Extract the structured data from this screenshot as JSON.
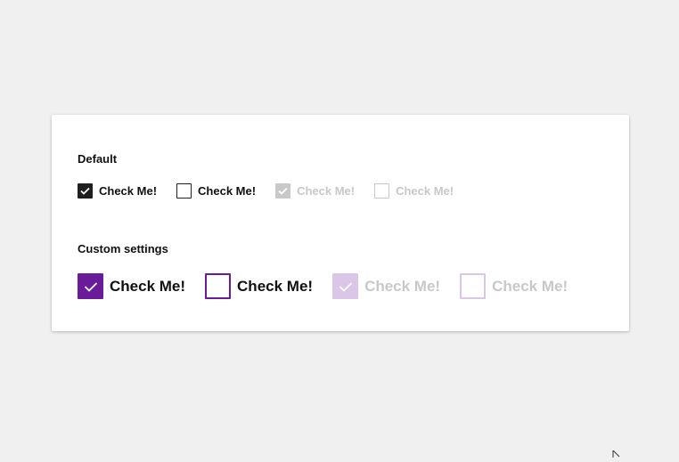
{
  "sections": [
    {
      "title": "Default",
      "checkboxes": [
        {
          "label": "Check Me!",
          "checked": true,
          "disabled": false
        },
        {
          "label": "Check Me!",
          "checked": false,
          "disabled": false
        },
        {
          "label": "Check Me!",
          "checked": true,
          "disabled": true
        },
        {
          "label": "Check Me!",
          "checked": false,
          "disabled": true
        }
      ]
    },
    {
      "title": "Custom settings",
      "checkboxes": [
        {
          "label": "Check Me!",
          "checked": true,
          "disabled": false
        },
        {
          "label": "Check Me!",
          "checked": false,
          "disabled": false
        },
        {
          "label": "Check Me!",
          "checked": true,
          "disabled": true
        },
        {
          "label": "Check Me!",
          "checked": false,
          "disabled": true
        }
      ]
    }
  ],
  "colors": {
    "default_checked_fill": "#1f1f1f",
    "default_border": "#1f1f1f",
    "default_text": "#111111",
    "default_disabled_fill": "#c8c8c8",
    "default_disabled_border": "#c8c8c8",
    "default_disabled_text": "#c8c8c8",
    "custom_checked_fill": "#6a1b9a",
    "custom_border": "#6a1b9a",
    "custom_disabled_fill": "#dcc6e8",
    "custom_disabled_border": "#dcc6e8",
    "custom_text": "#111111",
    "custom_disabled_text": "#c8c8c8"
  }
}
